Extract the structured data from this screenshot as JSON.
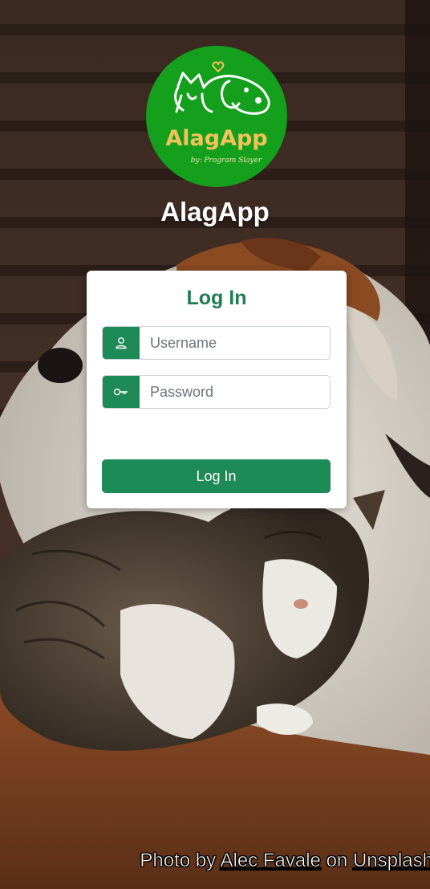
{
  "app": {
    "title": "AlagApp",
    "logo_text": "AlagApp",
    "logo_byline": "by: Program Slayer"
  },
  "login_card": {
    "title": "Log In",
    "username": {
      "placeholder": "Username",
      "value": "",
      "icon": "user-icon"
    },
    "password": {
      "placeholder": "Password",
      "value": "",
      "icon": "key-icon"
    },
    "submit_label": "Log In"
  },
  "credit": {
    "prefix": "Photo by",
    "author": "Alec Favale",
    "middle": "on",
    "site": "Unsplash"
  },
  "colors": {
    "brand_green": "#1e8a57",
    "logo_green": "#14a01d",
    "logo_text": "#f4c25a"
  }
}
